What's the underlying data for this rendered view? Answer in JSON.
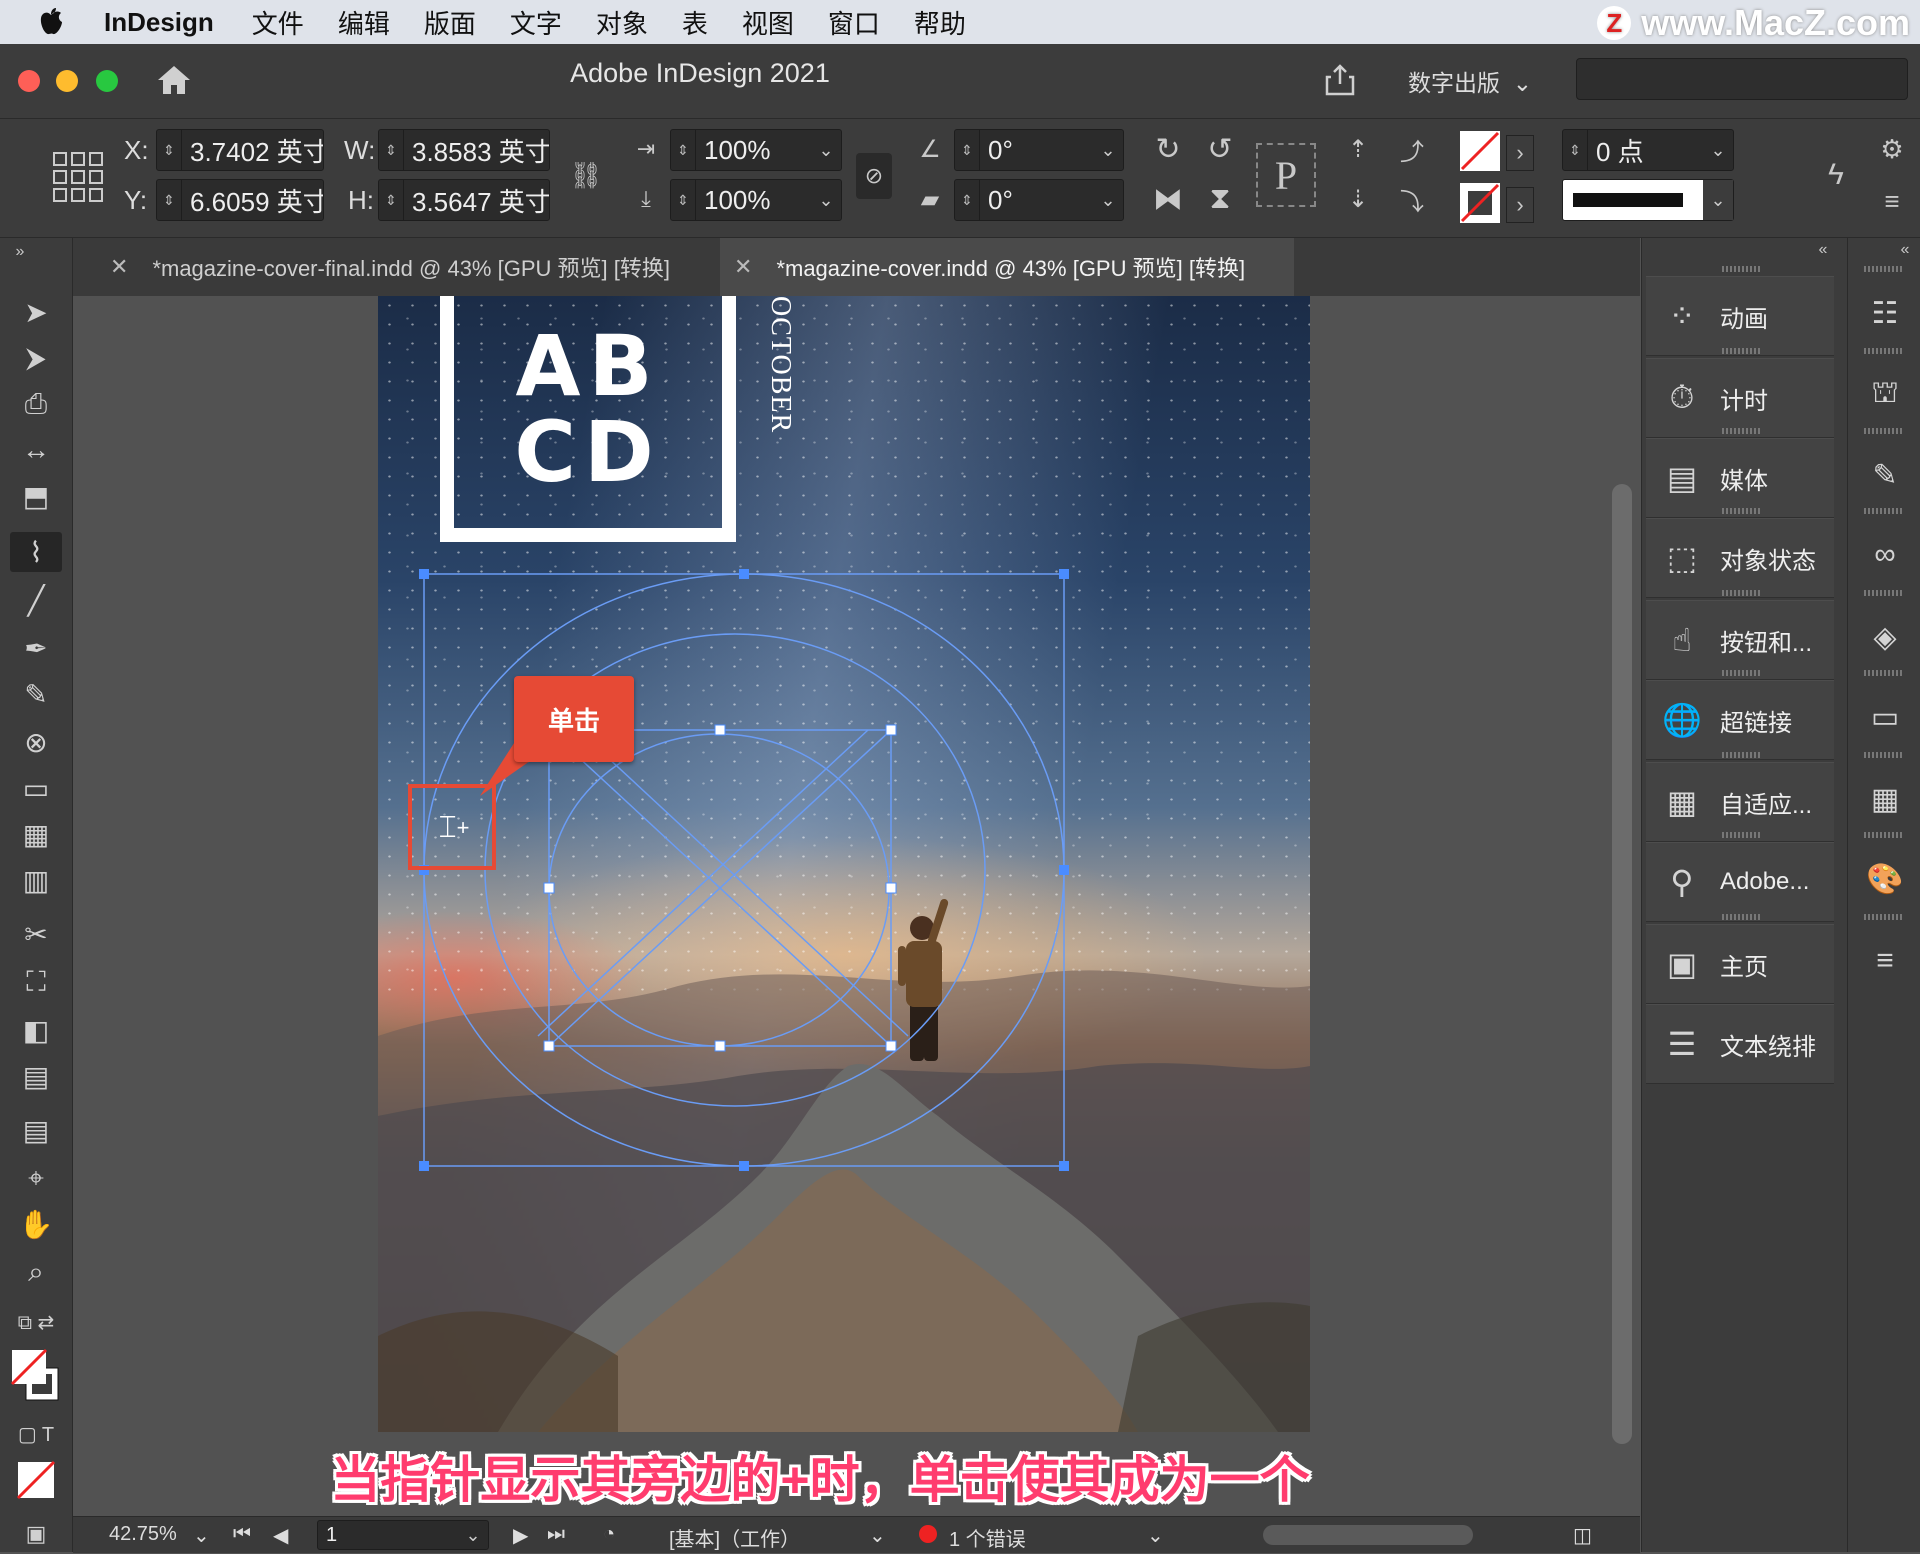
{
  "menubar": {
    "app_name": "InDesign",
    "items": [
      "文件",
      "编辑",
      "版面",
      "文字",
      "对象",
      "表",
      "视图",
      "窗口",
      "帮助"
    ],
    "watermark": "www.MacZ.com",
    "watermark_badge": "Z"
  },
  "window": {
    "title": "Adobe InDesign 2021",
    "publish_label": "数字出版",
    "search_placeholder": ""
  },
  "control": {
    "x_label": "X:",
    "x_value": "3.7402 英寸",
    "y_label": "Y:",
    "y_value": "6.6059 英寸",
    "w_label": "W:",
    "w_value": "3.8583 英寸",
    "h_label": "H:",
    "h_value": "3.5647 英寸",
    "scale_x": "100%",
    "scale_y": "100%",
    "rotate": "0°",
    "shear": "0°",
    "stroke_weight": "0 点",
    "p_glyph": "P"
  },
  "tabs": [
    {
      "label": "*magazine-cover-final.indd @ 43% [GPU 预览] [转换]",
      "active": false
    },
    {
      "label": "*magazine-cover.indd @ 43% [GPU 预览] [转换]",
      "active": true
    }
  ],
  "document": {
    "logo_line1": "AB",
    "logo_line2": "CD",
    "month": "OCTOBER"
  },
  "callout": {
    "label": "单击"
  },
  "subtitle": "当指针显示其旁边的+时，单击使其成为一个",
  "panels": [
    {
      "label": "动画",
      "icon": "animation-icon"
    },
    {
      "label": "计时",
      "icon": "timer-icon"
    },
    {
      "label": "媒体",
      "icon": "media-icon"
    },
    {
      "label": "对象状态",
      "icon": "object-states-icon"
    },
    {
      "label": "按钮和...",
      "icon": "buttons-icon"
    },
    {
      "label": "超链接",
      "icon": "hyperlinks-icon"
    },
    {
      "label": "自适应...",
      "icon": "liquid-layout-icon"
    },
    {
      "label": "Adobe...",
      "icon": "adobe-stock-icon"
    },
    {
      "label": "主页",
      "icon": "pages-icon"
    },
    {
      "label": "文本绕排",
      "icon": "text-wrap-icon"
    }
  ],
  "status": {
    "zoom": "42.75%",
    "page": "1",
    "profile": "[基本]（工作）",
    "errors": "1 个错误"
  },
  "colors": {
    "accent_red": "#e64a35",
    "subtitle": "#ff3c6e",
    "frame_blue": "#4a8cff"
  }
}
